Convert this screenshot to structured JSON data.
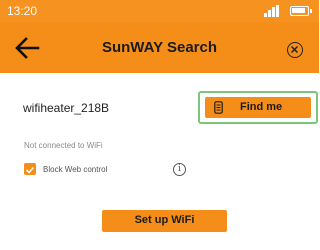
{
  "status_bar": {
    "time": "13:20",
    "signal_icon": "signal-icon",
    "battery_icon": "battery-icon"
  },
  "app_bar": {
    "title": "SunWAY Search",
    "back_icon": "arrow-left-icon",
    "close_icon": "close-circle-icon"
  },
  "device": {
    "name": "wifiheater_218B",
    "find_button": {
      "label": "Find me",
      "icon": "heater-icon"
    }
  },
  "connection": {
    "status_text": "Not connected to WiFi",
    "block_web_control": {
      "label": "Block Web control",
      "checked": true
    },
    "info_icon": "info-icon"
  },
  "setup_button": {
    "label": "Set up WiFi"
  },
  "colors": {
    "accent": "#f58e18",
    "status_bar": "#f59220",
    "highlight_border": "#7bc67b"
  }
}
